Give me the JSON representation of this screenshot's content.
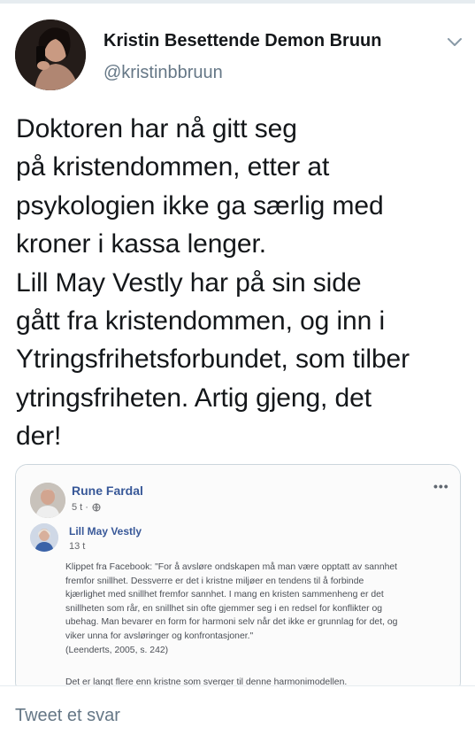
{
  "author": {
    "display_name": "Kristin Besettende Demon Bruun",
    "handle": "@kristinbbruun",
    "avatar_icon": "profile-photo"
  },
  "tweet": {
    "text": "Doktoren har nå gitt seg\npå kristendommen, etter at\npsykologien ikke ga særlig med\nkroner i kassa lenger.\nLill May Vestly har på sin side\ngått fra kristendommen, og inn i\nYtringsfrihetsforbundet, som tilber\nytringsfriheten. Artig gjeng, det\nder!"
  },
  "embedded_card": {
    "post_author": "Rune Fardal",
    "post_meta": "5 t ·",
    "more_icon": "•••",
    "comment_author": "Lill May Vestly",
    "comment_meta": "13 t",
    "comment_text": "Klippet fra Facebook: \"For å avsløre ondskapen må man være opptatt av sannhet\nfremfor snillhet. Dessverre er det i kristne miljøer en tendens til å forbinde\nkjærlighet med snillhet fremfor sannhet. I mang en kristen sammenheng er det\nsnillheten som rår, en snillhet sin ofte gjemmer seg i en redsel for konflikter og\nubehag. Man bevarer en form for harmoni selv når det ikke er grunnlag for det, og\nviker unna for avsløringer og konfrontasjoner.\"\n(Leenderts, 2005, s. 242)",
    "comment_text_2": "Det er langt flere enn kristne som sverger til denne harmonimodellen."
  },
  "reply": {
    "placeholder": "Tweet et svar"
  },
  "colors": {
    "link_blue": "#385898",
    "muted": "#657786",
    "border": "#ccd6dd"
  }
}
